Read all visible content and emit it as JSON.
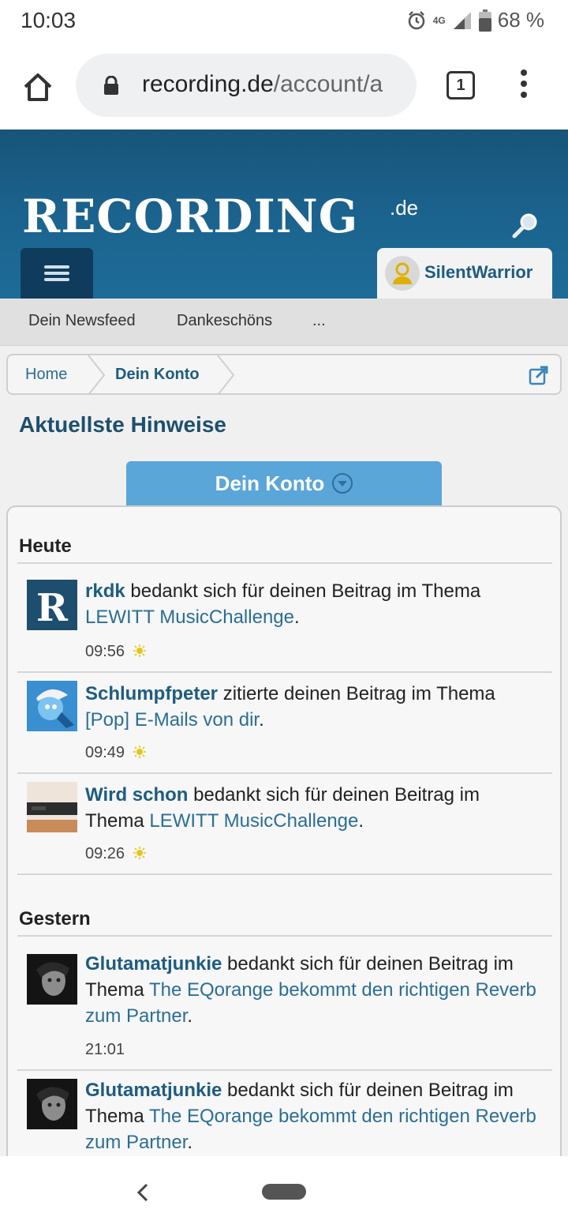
{
  "status_bar": {
    "time": "10:03",
    "network": "4G",
    "battery": "68 %"
  },
  "browser": {
    "url_host": "recording.de",
    "url_path": "/account/a",
    "tab_count": "1"
  },
  "site": {
    "logo": "RECORDING",
    "logo_suffix": ".de",
    "username": "SilentWarrior"
  },
  "subnav": {
    "items": [
      "Dein Newsfeed",
      "Dankeschöns",
      "..."
    ]
  },
  "breadcrumb": {
    "home": "Home",
    "current": "Dein Konto"
  },
  "page": {
    "heading": "Aktuellste Hinweise",
    "tab_label": "Dein Konto"
  },
  "sections": [
    {
      "title": "Heute",
      "items": [
        {
          "user": "rkdk",
          "action": "bedankt sich für deinen Beitrag im Thema",
          "thread": "LEWITT MusicChallenge",
          "time": "09:56",
          "icon": "sun-icon"
        },
        {
          "user": "Schlumpfpeter",
          "action": "zitierte deinen Beitrag im Thema",
          "thread": "[Pop] E-Mails von dir",
          "time": "09:49",
          "icon": "sun-icon"
        },
        {
          "user": "Wird schon",
          "action": "bedankt sich für deinen Beitrag im Thema",
          "thread": "LEWITT MusicChallenge",
          "time": "09:26",
          "icon": "sun-icon"
        }
      ]
    },
    {
      "title": "Gestern",
      "items": [
        {
          "user": "Glutamatjunkie",
          "action": "bedankt sich für deinen Beitrag im Thema",
          "thread": "The EQorange bekommt den richtigen Reverb zum Partner",
          "time": "21:01"
        },
        {
          "user": "Glutamatjunkie",
          "action": "bedankt sich für deinen Beitrag im Thema",
          "thread": "The EQorange bekommt den richtigen Reverb zum Partner",
          "time": ""
        }
      ]
    }
  ],
  "colors": {
    "header_blue": "#1b6490",
    "link": "#2a6e96",
    "tab_blue": "#5aa6d8"
  }
}
